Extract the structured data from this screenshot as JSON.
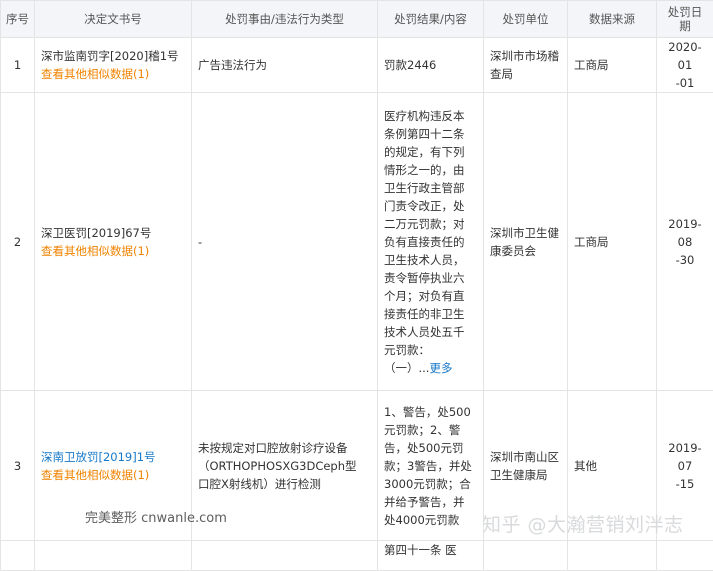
{
  "columns": [
    "序号",
    "决定文书号",
    "处罚事由/违法行为类型",
    "处罚结果/内容",
    "处罚单位",
    "数据来源",
    "处罚日期"
  ],
  "rows": [
    {
      "index": "1",
      "doc_lines": [
        "深市监南罚字[2020]稽1号"
      ],
      "similar": "查看其他相似数据(1)",
      "reason_lines": [
        "广告违法行为"
      ],
      "result_lines": [
        "罚款2446"
      ],
      "more": "",
      "unit_lines": [
        "深圳市市场稽",
        "查局"
      ],
      "source": "工商局",
      "date_lines": [
        "2020-01",
        "-01"
      ]
    },
    {
      "index": "2",
      "doc_lines": [
        "深卫医罚[2019]67号"
      ],
      "similar": "查看其他相似数据(1)",
      "reason_lines": [
        "-"
      ],
      "result_lines": [
        "医疗机构违反本",
        "条例第四十二条",
        "的规定，有下列",
        "情形之一的，由",
        "卫生行政主管部",
        "门责令改正，处",
        "二万元罚款；对",
        "负有直接责任的",
        "卫生技术人员，",
        "责令暂停执业六",
        "个月；对负有直",
        "接责任的非卫生",
        "技术人员处五千",
        "元罚款：",
        "（一）..."
      ],
      "more": "更多",
      "unit_lines": [
        "深圳市卫生健",
        "康委员会"
      ],
      "source": "工商局",
      "date_lines": [
        "2019-08",
        "-30"
      ]
    },
    {
      "index": "3",
      "doc_lines": [
        "深南卫放罚[2019]1号"
      ],
      "similar": "查看其他相似数据(1)",
      "reason_lines": [
        "未按规定对口腔放射诊疗设备",
        "（ORTHOPHOSXG3DCeph型",
        "口腔X射线机）进行检测"
      ],
      "result_lines": [
        "1、警告，处500",
        "元罚款；2、警",
        "告，处500元罚",
        "款；3警告，并处",
        "3000元罚款；合",
        "并给予警告，并",
        "处4000元罚款"
      ],
      "more": "",
      "unit_lines": [
        "深圳市南山区",
        "卫生健康局"
      ],
      "source": "其他",
      "date_lines": [
        "2019-07",
        "-15"
      ]
    },
    {
      "result_lines": [
        "第四十一条  医"
      ]
    }
  ],
  "watermarks": {
    "left": "完美整形 cnwanle.com",
    "right": "知乎 @大瀚营销刘泮志"
  },
  "colors": {
    "link": "#1678c8",
    "similar": "#f08300",
    "header_bg": "#f3f5f8"
  }
}
